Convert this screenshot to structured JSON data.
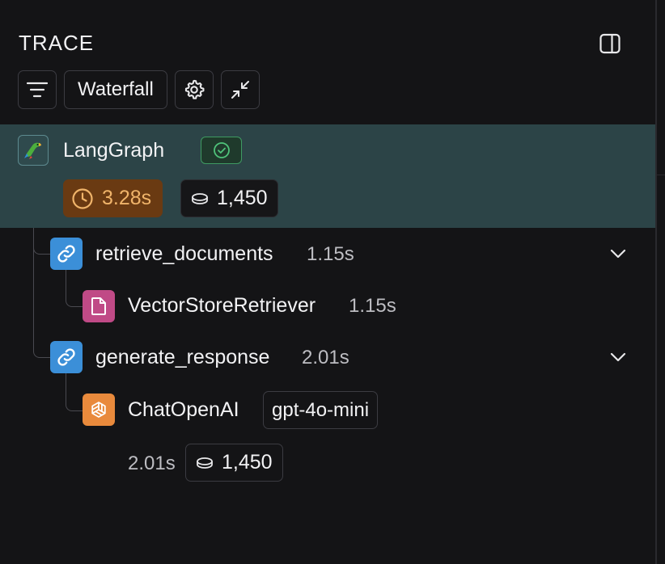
{
  "panel": {
    "title": "TRACE",
    "toolbar": {
      "view_mode_label": "Waterfall"
    }
  },
  "trace": {
    "root": {
      "name": "LangGraph",
      "icon": "parrot-icon",
      "status": "success",
      "latency": "3.28s",
      "tokens": "1,450"
    },
    "runs": [
      {
        "name": "retrieve_documents",
        "type": "chain",
        "latency": "1.15s",
        "expanded": true,
        "children": [
          {
            "name": "VectorStoreRetriever",
            "type": "retriever",
            "latency": "1.15s"
          }
        ]
      },
      {
        "name": "generate_response",
        "type": "chain",
        "latency": "2.01s",
        "expanded": true,
        "children": [
          {
            "name": "ChatOpenAI",
            "type": "llm",
            "model": "gpt-4o-mini",
            "latency": "2.01s",
            "tokens": "1,450"
          }
        ]
      }
    ]
  },
  "colors": {
    "background": "#141416",
    "selected_row": "#2c4447",
    "latency_badge_bg": "#6a3a12",
    "latency_badge_text": "#f0b46a",
    "success_green": "#3f9a62",
    "chain_blue": "#3b8fd8",
    "retriever_pink": "#c04a86",
    "llm_orange": "#e98a3c"
  }
}
